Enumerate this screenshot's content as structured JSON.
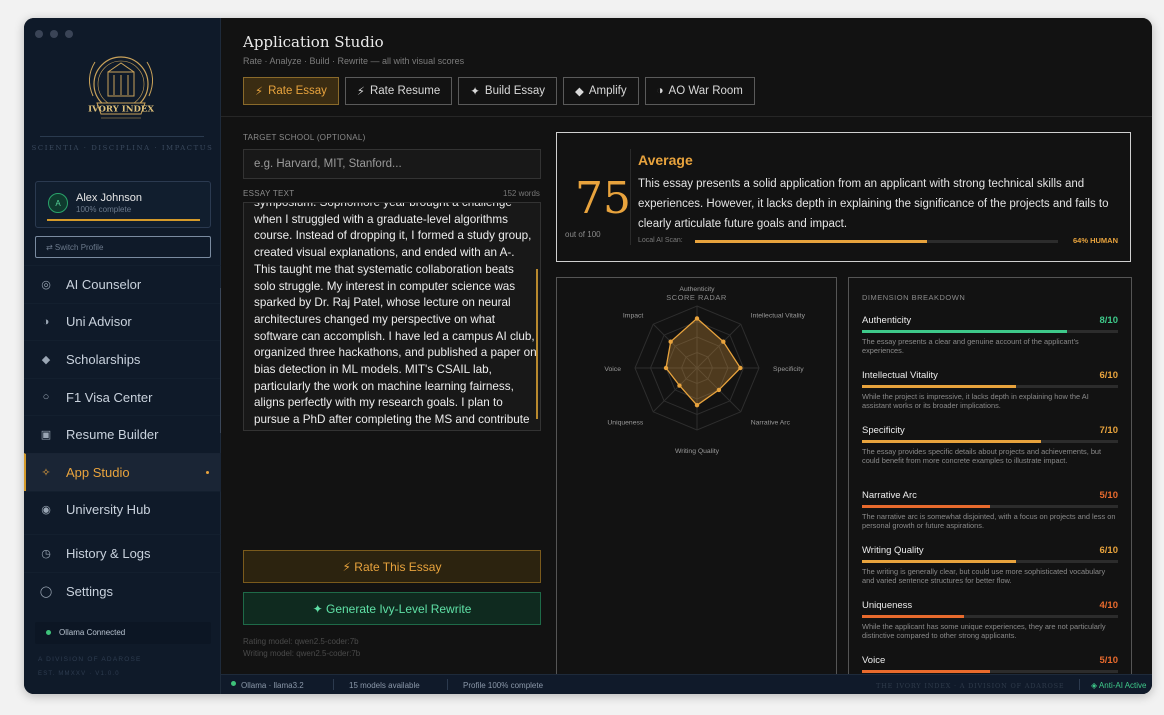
{
  "sidebar": {
    "brand": "IVORY INDEX",
    "motto": "SCIENTIA · DISCIPLINA · IMPACTUS",
    "profile": {
      "name": "Alex Johnson",
      "initial": "A",
      "status": "100% complete",
      "progress": 1.0
    },
    "switch_label": "⇄ Switch Profile",
    "items": [
      {
        "label": "AI Counselor",
        "icon": "◎"
      },
      {
        "label": "Uni Advisor",
        "icon": "◑"
      },
      {
        "label": "Scholarships",
        "icon": "◆"
      },
      {
        "label": "F1 Visa Center",
        "icon": "○"
      },
      {
        "label": "Resume Builder",
        "icon": "▣"
      },
      {
        "label": "App Studio",
        "icon": "✧"
      },
      {
        "label": "University Hub",
        "icon": "◉"
      },
      {
        "label": "History & Logs",
        "icon": "◷"
      },
      {
        "label": "Settings",
        "icon": "◯"
      }
    ],
    "ollama": "Ollama Connected",
    "division": "A DIVISION OF ADAROSE",
    "est": "EST. MMXXV · V1.0.0"
  },
  "header": {
    "title": "Application Studio",
    "subtitle": "Rate · Analyze · Build · Rewrite — all with visual scores",
    "tabs": [
      {
        "label": "Rate Essay",
        "icon": "⚡"
      },
      {
        "label": "Rate Resume",
        "icon": "⚡"
      },
      {
        "label": "Build Essay",
        "icon": "✦"
      },
      {
        "label": "Amplify",
        "icon": "◆"
      },
      {
        "label": "AO War Room",
        "icon": "◑"
      }
    ]
  },
  "form": {
    "school_label": "TARGET SCHOOL (OPTIONAL)",
    "school_placeholder": "e.g. Harvard, MIT, Stanford...",
    "essay_label": "ESSAY TEXT",
    "word_count": "152 words",
    "essay_text": "symposium. Sophomore year brought a challenge when I struggled with a graduate-level algorithms course. Instead of dropping it, I formed a study group, created visual explanations, and ended with an A-. This taught me that systematic collaboration beats solo struggle. My interest in computer science was sparked by Dr. Raj Patel, whose lecture on neural architectures changed my perspective on what software can accomplish. I have led a campus AI club, organized three hackathons, and published a paper on bias detection in ML models. MIT's CSAIL lab, particularly the work on machine learning fairness, aligns perfectly with my research goals. I plan to pursue a PhD after completing the MS and contribute to open-source AI safety tools.",
    "rate_button": "⚡ Rate This Essay",
    "generate_button": "✦ Generate Ivy-Level Rewrite",
    "rating_model": "Rating model: qwen2.5-coder:7b",
    "writing_model": "Writing model: qwen2.5-coder:7b"
  },
  "result": {
    "score": "75",
    "out_of": "out of 100",
    "verdict": "Average",
    "summary": "This essay presents a solid application from an applicant with strong technical skills and experiences. However, it lacks depth in explaining the significance of the projects and fails to clearly articulate future goals and impact.",
    "ai_label": "Local AI Scan:",
    "human_fraction": 0.64,
    "ai_pct": "64% HUMAN"
  },
  "radar": {
    "title": "SCORE RADAR"
  },
  "breakdown": {
    "title": "DIMENSION BREAKDOWN"
  },
  "chart_data": {
    "type": "radar",
    "title": "SCORE RADAR",
    "categories": [
      "Authenticity",
      "Intellectual Vitality",
      "Specificity",
      "Narrative Arc",
      "Writing Quality",
      "Uniqueness",
      "Voice",
      "Impact"
    ],
    "values": [
      8,
      6,
      7,
      5,
      6,
      4,
      5,
      6
    ],
    "max": 10
  },
  "dimensions": [
    {
      "name": "Authenticity",
      "score": "8/10",
      "value": 8,
      "color": "#3ec98a",
      "desc": "The essay presents a clear and genuine account of the applicant's experiences."
    },
    {
      "name": "Intellectual Vitality",
      "score": "6/10",
      "value": 6,
      "color": "#e8a33d",
      "desc": "While the project is impressive, it lacks depth in explaining how the AI assistant works or its broader implications."
    },
    {
      "name": "Specificity",
      "score": "7/10",
      "value": 7,
      "color": "#e8a33d",
      "desc": "The essay provides specific details about projects and achievements, but could benefit from more concrete examples to illustrate impact."
    },
    {
      "name": "Narrative Arc",
      "score": "5/10",
      "value": 5,
      "color": "#e86a2d",
      "desc": "The narrative arc is somewhat disjointed, with a focus on projects and less on personal growth or future aspirations."
    },
    {
      "name": "Writing Quality",
      "score": "6/10",
      "value": 6,
      "color": "#e8a33d",
      "desc": "The writing is generally clear, but could use more sophisticated vocabulary and varied sentence structures for better flow."
    },
    {
      "name": "Uniqueness",
      "score": "4/10",
      "value": 4,
      "color": "#e86a2d",
      "desc": "While the applicant has some unique experiences, they are not particularly distinctive compared to other strong applicants."
    },
    {
      "name": "Voice",
      "score": "5/10",
      "value": 5,
      "color": "#e86a2d",
      "desc": ""
    }
  ],
  "status": {
    "model": "Ollama · llama3.2",
    "available": "15 models available",
    "profile": "Profile 100% complete",
    "brand": "THE IVORY INDEX · A DIVISION OF ADAROSE",
    "anti_ai": "◈ Anti-AI Active"
  },
  "colors": {
    "accent": "#e8a33d",
    "green": "#3ec98a",
    "sidebar": "#0f1a29"
  }
}
